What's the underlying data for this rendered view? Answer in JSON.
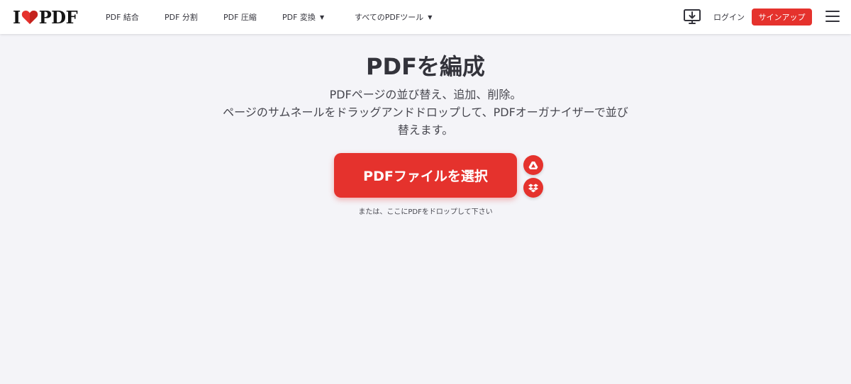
{
  "header": {
    "logo": {
      "left": "I",
      "right": "PDF"
    },
    "nav": [
      {
        "label": "PDF 結合"
      },
      {
        "label": "PDF 分割"
      },
      {
        "label": "PDF 圧縮"
      },
      {
        "label": "PDF 変換",
        "caret": "▼"
      },
      {
        "label": "すべてのPDFツール",
        "caret": "▼"
      }
    ],
    "login_label": "ログイン",
    "signup_label": "サインアップ"
  },
  "main": {
    "title": "PDFを編成",
    "subtitle_line1": "PDFページの並び替え、追加、削除。",
    "subtitle_line2": "ページのサムネールをドラッグアンドドロップして、PDFオーガナイザーで並び",
    "subtitle_line3": "替えます。",
    "select_button_label": "PDFファイルを選択",
    "drop_hint": "または、ここにPDFをドロップして下さい"
  },
  "colors": {
    "accent": "#e5322d",
    "background": "#f4f4f8",
    "text": "#33333b"
  },
  "icons": [
    "heart-logo-icon",
    "desktop-download-icon",
    "hamburger-menu-icon",
    "google-drive-icon",
    "dropbox-icon"
  ]
}
